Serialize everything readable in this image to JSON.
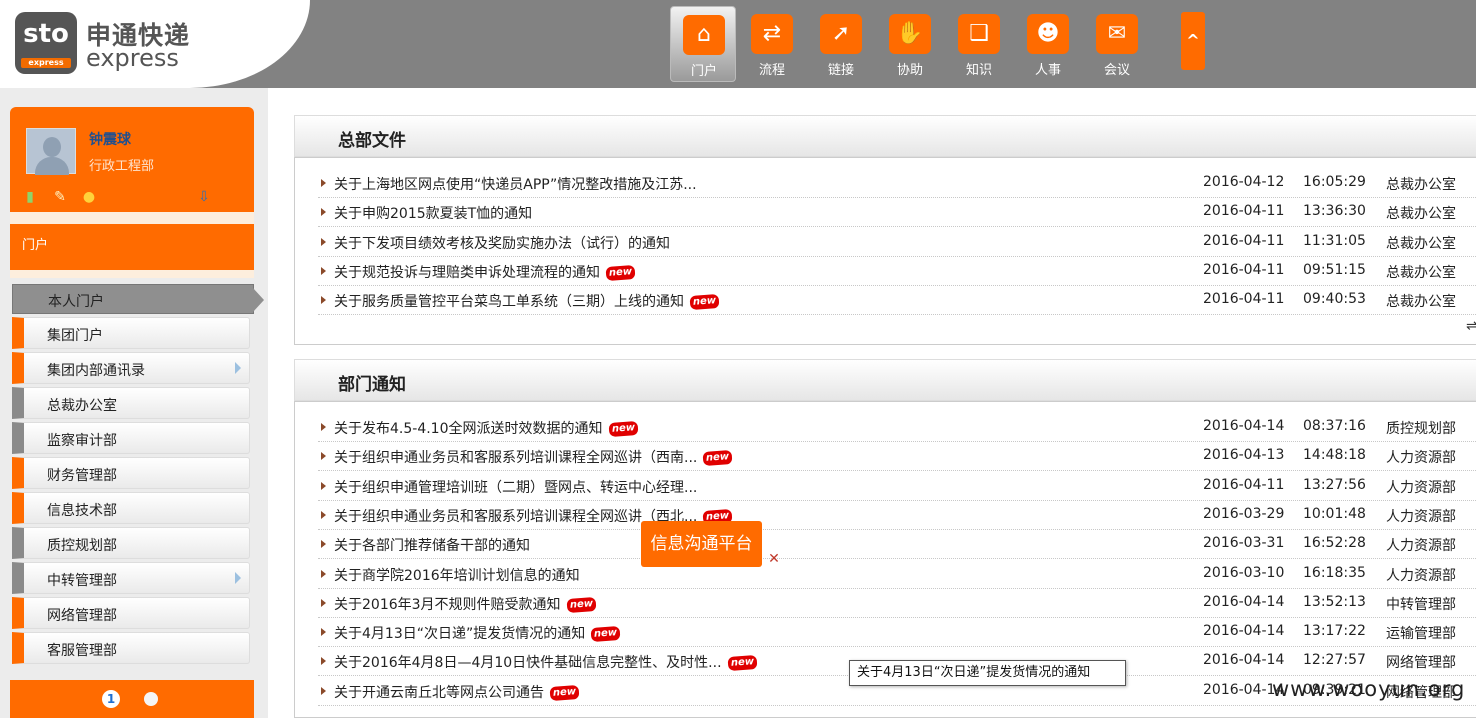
{
  "brand": {
    "cn": "申通快递",
    "en": "express",
    "mark": "sto",
    "mark_sub": "express"
  },
  "nav": [
    {
      "label": "门户",
      "icon": "home-icon",
      "glyph": "⌂",
      "active": true
    },
    {
      "label": "流程",
      "icon": "signpost-icon",
      "glyph": "⇄"
    },
    {
      "label": "链接",
      "icon": "cursor-icon",
      "glyph": "➚"
    },
    {
      "label": "协助",
      "icon": "hand-icon",
      "glyph": "✋"
    },
    {
      "label": "知识",
      "icon": "book-icon",
      "glyph": "❑"
    },
    {
      "label": "人事",
      "icon": "people-icon",
      "glyph": "☻"
    },
    {
      "label": "会议",
      "icon": "chat-icon",
      "glyph": "✉"
    }
  ],
  "nav_collapse": "^",
  "user": {
    "name": "钟震球",
    "dept": "行政工程部"
  },
  "sidebar": {
    "portal_tab": "门户",
    "active_item": "本人门户",
    "items": [
      {
        "label": "集团门户",
        "accent": "orange",
        "submenu": false
      },
      {
        "label": "集团内部通讯录",
        "accent": "orange",
        "submenu": true
      },
      {
        "label": "总裁办公室",
        "accent": "grey",
        "submenu": false
      },
      {
        "label": "监察审计部",
        "accent": "grey",
        "submenu": false
      },
      {
        "label": "财务管理部",
        "accent": "orange",
        "submenu": false
      },
      {
        "label": "信息技术部",
        "accent": "orange",
        "submenu": false
      },
      {
        "label": "质控规划部",
        "accent": "grey",
        "submenu": false
      },
      {
        "label": "中转管理部",
        "accent": "grey",
        "submenu": true
      },
      {
        "label": "网络管理部",
        "accent": "orange",
        "submenu": false
      },
      {
        "label": "客服管理部",
        "accent": "orange",
        "submenu": false
      }
    ],
    "pages": [
      "1"
    ]
  },
  "hq_files": {
    "title": "总部文件",
    "rows": [
      {
        "title": "关于上海地区网点使用“快递员APP”情况整改措施及江苏...",
        "date": "2016-04-12",
        "time": "16:05:29",
        "dept": "总裁办公室",
        "new": false
      },
      {
        "title": "关于申购2015款夏装T恤的通知",
        "date": "2016-04-11",
        "time": "13:36:30",
        "dept": "总裁办公室",
        "new": false
      },
      {
        "title": "关于下发项目绩效考核及奖励实施办法（试行）的通知",
        "date": "2016-04-11",
        "time": "11:31:05",
        "dept": "总裁办公室",
        "new": false
      },
      {
        "title": "关于规范投诉与理赔类申诉处理流程的通知",
        "date": "2016-04-11",
        "time": "09:51:15",
        "dept": "总裁办公室",
        "new": true
      },
      {
        "title": "关于服务质量管控平台菜鸟工单系统（三期）上线的通知",
        "date": "2016-04-11",
        "time": "09:40:53",
        "dept": "总裁办公室",
        "new": true
      }
    ]
  },
  "dept_notices": {
    "title": "部门通知",
    "rows": [
      {
        "title": "关于发布4.5-4.10全网派送时效数据的通知",
        "date": "2016-04-14",
        "time": "08:37:16",
        "dept": "质控规划部",
        "new": true
      },
      {
        "title": "关于组织申通业务员和客服系列培训课程全网巡讲（西南...",
        "date": "2016-04-13",
        "time": "14:48:18",
        "dept": "人力资源部",
        "new": true
      },
      {
        "title": "关于组织申通管理培训班（二期）暨网点、转运中心经理...",
        "date": "2016-04-11",
        "time": "13:27:56",
        "dept": "人力资源部",
        "new": false
      },
      {
        "title": "关于组织申通业务员和客服系列培训课程全网巡讲（西北...",
        "date": "2016-03-29",
        "time": "10:01:48",
        "dept": "人力资源部",
        "new": true
      },
      {
        "title": "关于各部门推荐储备干部的通知",
        "date": "2016-03-31",
        "time": "16:52:28",
        "dept": "人力资源部",
        "new": false
      },
      {
        "title": "关于商学院2016年培训计划信息的通知",
        "date": "2016-03-10",
        "time": "16:18:35",
        "dept": "人力资源部",
        "new": false
      },
      {
        "title": "关于2016年3月不规则件赔受款通知",
        "date": "2016-04-14",
        "time": "13:52:13",
        "dept": "中转管理部",
        "new": true
      },
      {
        "title": "关于4月13日“次日递”提发货情况的通知",
        "date": "2016-04-14",
        "time": "13:17:22",
        "dept": "运输管理部",
        "new": true
      },
      {
        "title": "关于2016年4月8日—4月10日快件基础信息完整性、及时性...",
        "date": "2016-04-14",
        "time": "12:27:57",
        "dept": "网络管理部",
        "new": true
      },
      {
        "title": "关于开通云南丘北等网点公司通告",
        "date": "2016-04-14",
        "time": "09:39:21",
        "dept": "网络管理部",
        "new": true
      }
    ]
  },
  "new_badge": "new",
  "float_button": "信息沟通平台",
  "tooltip": "关于4月13日“次日递”提发货情况的通知",
  "watermark": "www.wooyun.org",
  "colors": {
    "accent": "#ff6b00",
    "header": "#828282",
    "link": "#1f4f8f"
  }
}
